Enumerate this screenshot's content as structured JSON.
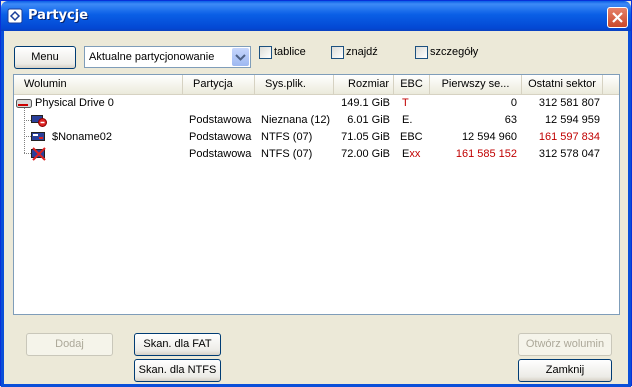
{
  "window": {
    "title": "Partycje"
  },
  "toolbar": {
    "menu_label": "Menu",
    "combo_value": "Aktualne partycjonowanie",
    "checkboxes": [
      {
        "label": "tablice",
        "checked": false
      },
      {
        "label": "znajdź",
        "checked": false
      },
      {
        "label": "szczegóły",
        "checked": false
      }
    ]
  },
  "table": {
    "columns": [
      "Wolumin",
      "Partycja",
      "Sys.plik.",
      "Rozmiar",
      "EBC",
      "Pierwszy se...",
      "Ostatni sektor"
    ],
    "rows": [
      {
        "volume": "Physical Drive 0",
        "partition": "",
        "fs": "",
        "size": "149.1 GiB",
        "ebc": "T",
        "first": "0",
        "last": "312 581 807",
        "icon": "hard-drive-icon",
        "ebc_red": true,
        "first_red": false,
        "last_red": false
      },
      {
        "volume": "",
        "partition": "Podstawowa",
        "fs": "Nieznana (12)",
        "size": "6.01 GiB",
        "ebc": "E.",
        "first": "63",
        "last": "12 594 959",
        "icon": "partition-unknown-icon",
        "ebc_red": false,
        "first_red": false,
        "last_red": false
      },
      {
        "volume": "$Noname02",
        "partition": "Podstawowa",
        "fs": "NTFS (07)",
        "size": "71.05 GiB",
        "ebc": "EBC",
        "first": "12 594 960",
        "last": "161 597 834",
        "icon": "partition-icon",
        "ebc_red": false,
        "first_red": false,
        "last_red": true
      },
      {
        "volume": "",
        "partition": "Podstawowa",
        "fs": "NTFS (07)",
        "size": "72.00 GiB",
        "ebc": "Exx",
        "ebc_prefix": "E",
        "ebc_suffix": "xx",
        "first": "161 585 152",
        "last": "312 578 047",
        "icon": "partition-error-icon",
        "ebc_red": false,
        "first_red": true,
        "last_red": false
      }
    ]
  },
  "buttons": {
    "add": "Dodaj",
    "scan_fat": "Skan. dla FAT",
    "scan_ntfs": "Skan. dla NTFS",
    "open_volume": "Otwórz wolumin",
    "close": "Zamknij"
  },
  "colors": {
    "titlebar": "#0a5fe6",
    "highlight_red": "#c00000",
    "face": "#ece9d8"
  }
}
